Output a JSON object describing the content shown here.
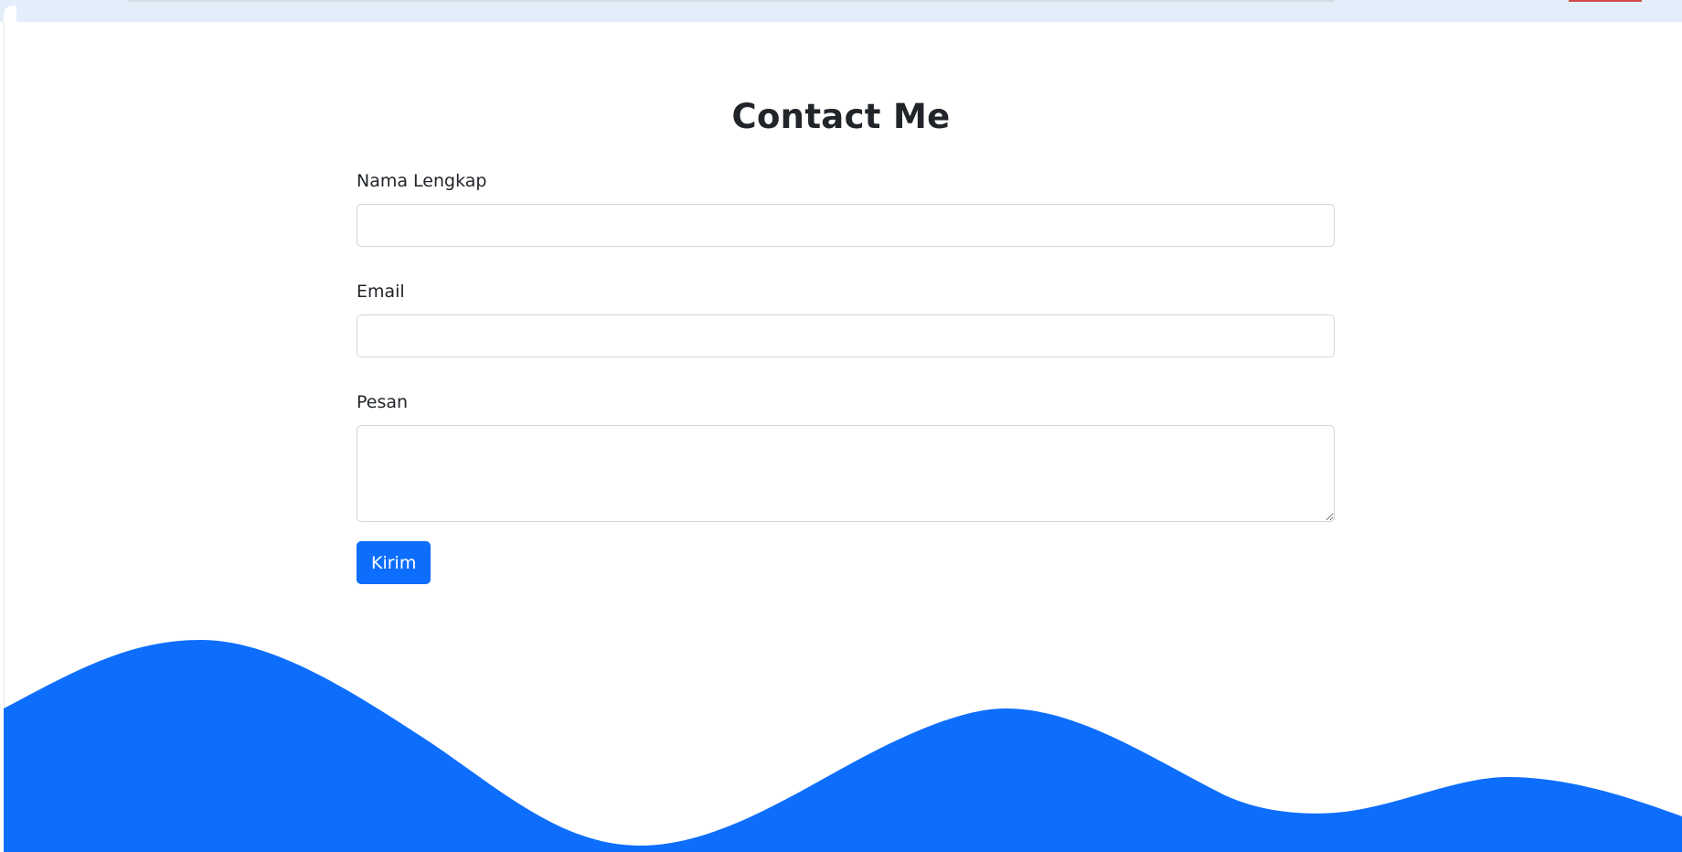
{
  "contact": {
    "title": "Contact Me",
    "fields": {
      "name_label": "Nama Lengkap",
      "name_value": "",
      "email_label": "Email",
      "email_value": "",
      "message_label": "Pesan",
      "message_value": ""
    },
    "submit_label": "Kirim"
  },
  "colors": {
    "accent": "#0d6efd",
    "text": "#212529",
    "input_border": "#cfd4da",
    "browser_bar": "#e4eefb"
  }
}
